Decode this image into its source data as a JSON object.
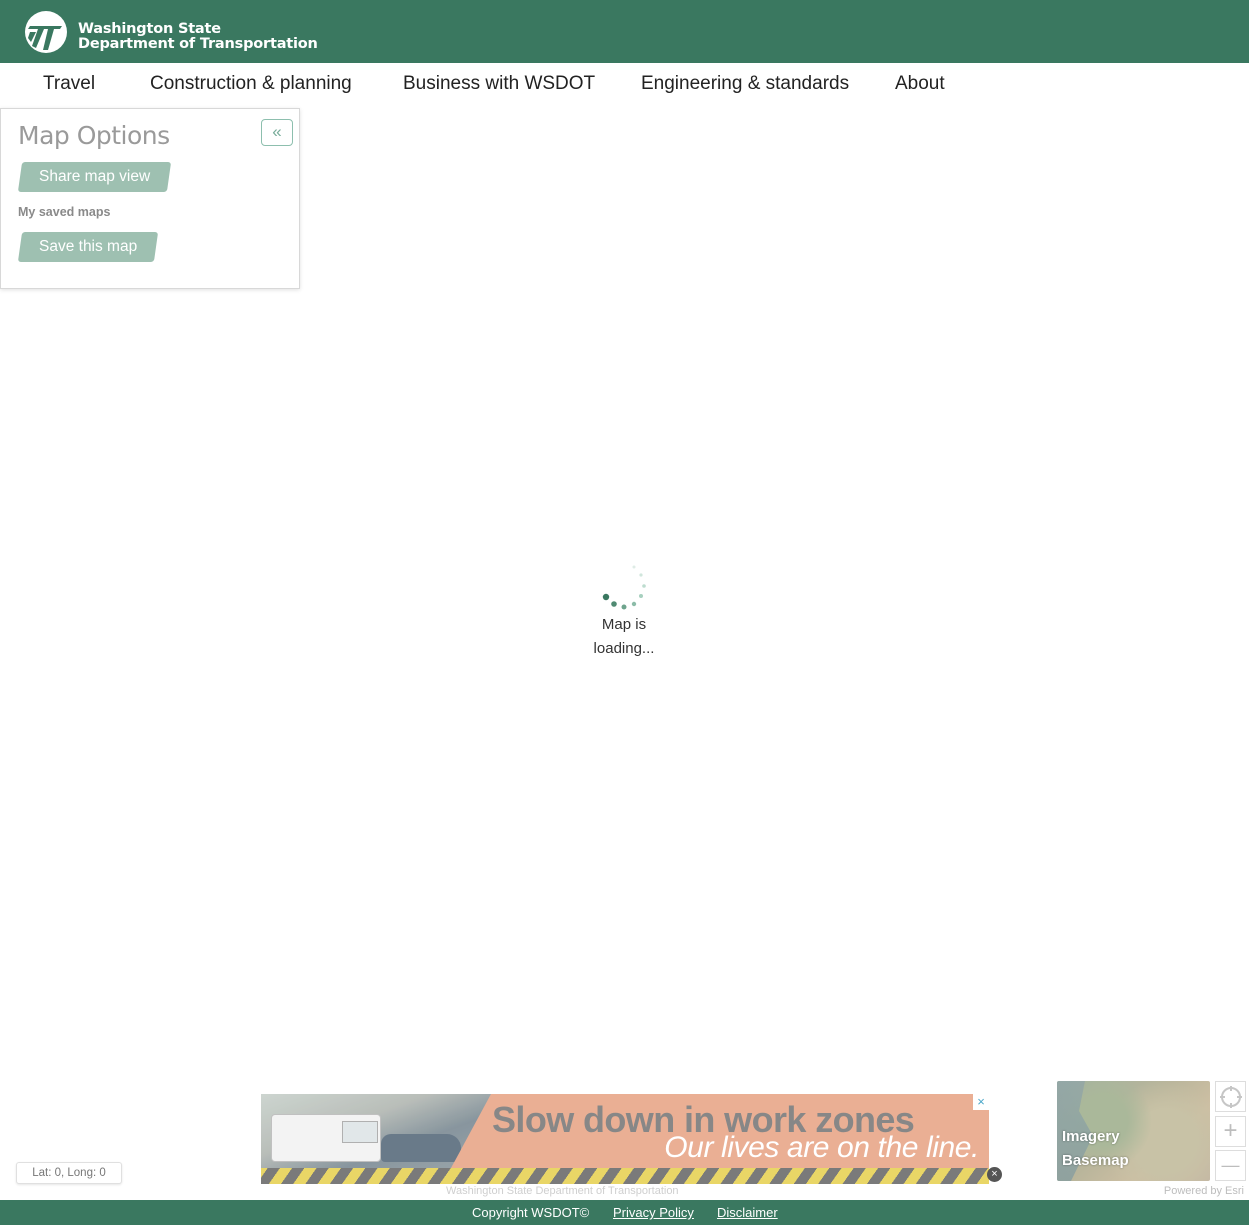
{
  "header": {
    "agency_line1": "Washington State",
    "agency_line2": "Department of Transportation"
  },
  "nav": {
    "items": [
      {
        "label": "Travel"
      },
      {
        "label": "Construction & planning"
      },
      {
        "label": "Business with WSDOT"
      },
      {
        "label": "Engineering & standards"
      },
      {
        "label": "About"
      }
    ]
  },
  "panel": {
    "title": "Map Options",
    "collapse_glyph": "«",
    "share_button": "Share map view",
    "saved_label": "My saved maps",
    "save_button": "Save this map"
  },
  "map": {
    "loading_line1": "Map is",
    "loading_line2": "loading...",
    "coords": "Lat: 0, Long: 0",
    "attribution": "Washington State Department of Transportation",
    "powered_by": "Powered by Esri"
  },
  "banner": {
    "headline": "Slow down in work zones",
    "subline": "Our lives are on the line.",
    "close_x": "×",
    "close_round": "×"
  },
  "basemap": {
    "label_line1": "Imagery",
    "label_line2": "Basemap"
  },
  "controls": {
    "zoom_in": "+",
    "zoom_out": "—"
  },
  "footer": {
    "copyright": "Copyright WSDOT©",
    "privacy": "Privacy Policy",
    "disclaimer": "Disclaimer"
  },
  "colors": {
    "brand_green": "#3a7860",
    "button_green": "#9ec0b1",
    "banner_salmon": "#e9a98c"
  }
}
